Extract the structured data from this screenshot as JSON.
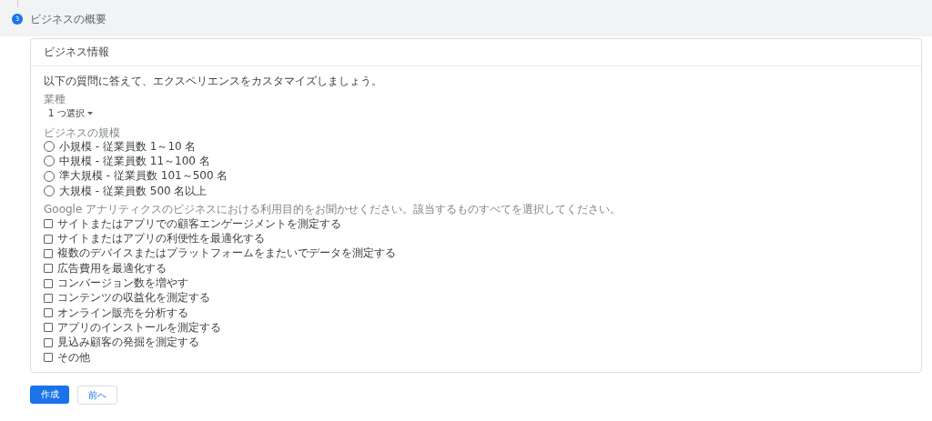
{
  "step": {
    "number": "3",
    "title": "ビジネスの概要"
  },
  "card": {
    "title": "ビジネス情報",
    "intro": "以下の質問に答えて、エクスペリエンスをカスタマイズしましょう。",
    "industry": {
      "label": "業種",
      "value": "1 つ選択"
    },
    "size": {
      "label": "ビジネスの規模",
      "options": [
        {
          "label": "小規模 - 従業員数 1～10 名",
          "selected": false
        },
        {
          "label": "中規模 - 従業員数 11～100 名",
          "selected": false
        },
        {
          "label": "準大規模 - 従業員数 101～500 名",
          "selected": false
        },
        {
          "label": "大規模 - 従業員数 500 名以上",
          "selected": false
        }
      ]
    },
    "purpose": {
      "label": "Google アナリティクスのビジネスにおける利用目的をお聞かせください。該当するものすべてを選択してください。",
      "options": [
        {
          "label": "サイトまたはアプリでの顧客エンゲージメントを測定する",
          "checked": false
        },
        {
          "label": "サイトまたはアプリの利便性を最適化する",
          "checked": false
        },
        {
          "label": "複数のデバイスまたはプラットフォームをまたいでデータを測定する",
          "checked": false
        },
        {
          "label": "広告費用を最適化する",
          "checked": false
        },
        {
          "label": "コンバージョン数を増やす",
          "checked": false
        },
        {
          "label": "コンテンツの収益化を測定する",
          "checked": false
        },
        {
          "label": "オンライン販売を分析する",
          "checked": false
        },
        {
          "label": "アプリのインストールを測定する",
          "checked": false
        },
        {
          "label": "見込み顧客の発掘を測定する",
          "checked": false
        },
        {
          "label": "その他",
          "checked": false
        }
      ]
    }
  },
  "buttons": {
    "primary": "作成",
    "secondary": "前へ"
  }
}
